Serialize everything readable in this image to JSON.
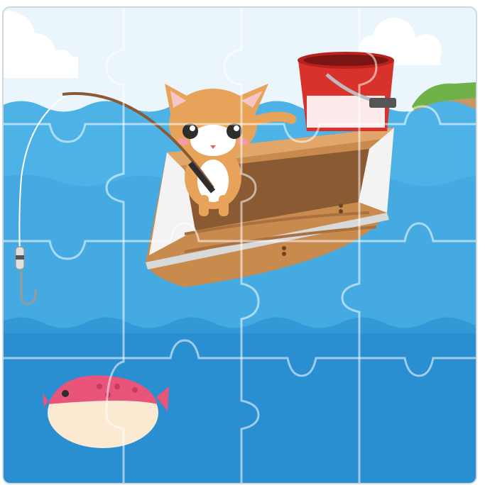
{
  "puzzle": {
    "rows": 4,
    "cols": 4,
    "piece_count": 16
  },
  "scene": {
    "sky_color": "#ffffff",
    "water_light": "#4db3e6",
    "water_mid": "#3da4dc",
    "water_deep": "#2a8fd1",
    "boat_color": "#c98a4e",
    "boat_trim": "#8a5a33",
    "bucket_color": "#d9312b",
    "cat_color": "#e8a35a",
    "fish_color": "#e9547a",
    "island_color": "#6fb24a"
  },
  "icons": {
    "cat": "cat-icon",
    "boat": "boat-icon",
    "bucket": "bucket-icon",
    "fish": "fish-icon",
    "hook": "hook-icon",
    "float": "float-icon"
  }
}
